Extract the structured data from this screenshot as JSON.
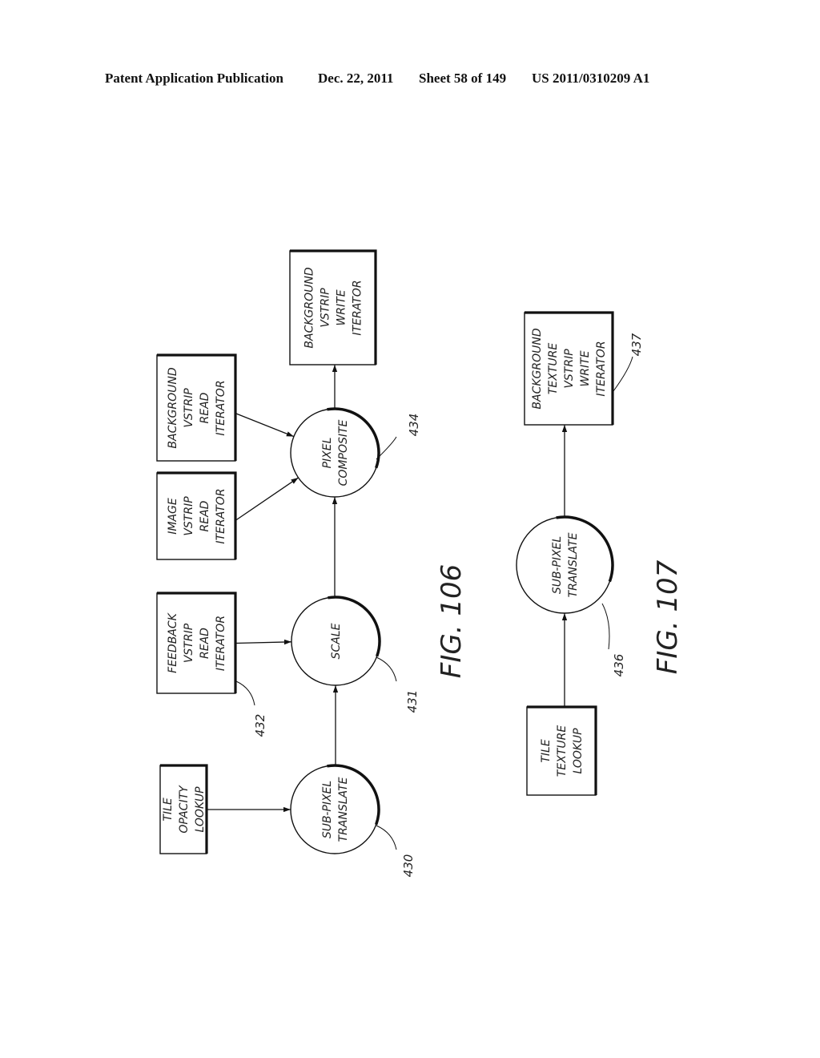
{
  "header": {
    "publication": "Patent Application Publication",
    "date": "Dec. 22, 2011",
    "sheet": "Sheet 58 of 149",
    "number": "US 2011/0310209 A1"
  },
  "figures": [
    {
      "id": "fig106",
      "caption": "FIG. 106",
      "boxes": [
        {
          "id": "tile-opacity-lookup",
          "lines": [
            "TILE",
            "OPACITY",
            "LOOKUP"
          ]
        },
        {
          "id": "feedback-vstrip-read-iterator",
          "lines": [
            "FEEDBACK",
            "VSTRIP",
            "READ",
            "ITERATOR"
          ],
          "ref": "432"
        },
        {
          "id": "image-vstrip-read-iterator",
          "lines": [
            "IMAGE",
            "VSTRIP",
            "READ",
            "ITERATOR"
          ]
        },
        {
          "id": "background-vstrip-read-iterator",
          "lines": [
            "BACKGROUND",
            "VSTRIP",
            "READ",
            "ITERATOR"
          ]
        },
        {
          "id": "background-vstrip-write-iterator",
          "lines": [
            "BACKGROUND",
            "VSTRIP",
            "WRITE",
            "ITERATOR"
          ]
        }
      ],
      "nodes": [
        {
          "id": "sub-pixel-translate",
          "lines": [
            "SUB-PIXEL",
            "TRANSLATE"
          ],
          "ref": "430"
        },
        {
          "id": "scale",
          "lines": [
            "SCALE"
          ],
          "ref": "431"
        },
        {
          "id": "pixel-composite",
          "lines": [
            "PIXEL",
            "COMPOSITE"
          ],
          "ref": "434"
        }
      ],
      "edges": [
        [
          "tile-opacity-lookup",
          "sub-pixel-translate"
        ],
        [
          "sub-pixel-translate",
          "scale"
        ],
        [
          "feedback-vstrip-read-iterator",
          "scale"
        ],
        [
          "scale",
          "pixel-composite"
        ],
        [
          "image-vstrip-read-iterator",
          "pixel-composite"
        ],
        [
          "background-vstrip-read-iterator",
          "pixel-composite"
        ],
        [
          "pixel-composite",
          "background-vstrip-write-iterator"
        ]
      ]
    },
    {
      "id": "fig107",
      "caption": "FIG. 107",
      "boxes": [
        {
          "id": "tile-texture-lookup",
          "lines": [
            "TILE",
            "TEXTURE",
            "LOOKUP"
          ]
        },
        {
          "id": "background-texture-vstrip-write-iterator",
          "lines": [
            "BACKGROUND",
            "TEXTURE",
            "VSTRIP",
            "WRITE",
            "ITERATOR"
          ],
          "ref": "437"
        }
      ],
      "nodes": [
        {
          "id": "sub-pixel-translate-2",
          "lines": [
            "SUB-PIXEL",
            "TRANSLATE"
          ],
          "ref": "436"
        }
      ],
      "edges": [
        [
          "tile-texture-lookup",
          "sub-pixel-translate-2"
        ],
        [
          "sub-pixel-translate-2",
          "background-texture-vstrip-write-iterator"
        ]
      ]
    }
  ]
}
